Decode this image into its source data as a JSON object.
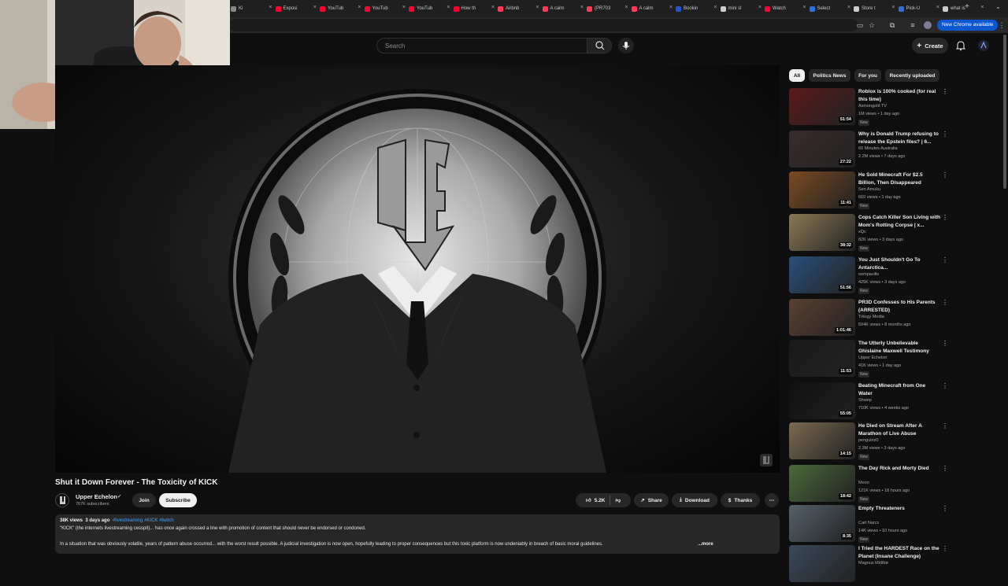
{
  "browser": {
    "tabs": [
      {
        "label": "Ki",
        "color": "#888888"
      },
      {
        "label": "Exposi",
        "color": "#ff0033"
      },
      {
        "label": "YouTub",
        "color": "#ff0033"
      },
      {
        "label": "YouTub",
        "color": "#ff0033"
      },
      {
        "label": "YouTub",
        "color": "#ff0033"
      },
      {
        "label": "How th",
        "color": "#ff0033"
      },
      {
        "label": "Airbnb",
        "color": "#ff385c"
      },
      {
        "label": "A calm",
        "color": "#ff385c"
      },
      {
        "label": "(PR703",
        "color": "#ff385c"
      },
      {
        "label": "A calm",
        "color": "#ff385c"
      },
      {
        "label": "Bookin",
        "color": "#2956c7"
      },
      {
        "label": "mini sl",
        "color": "#cccccc"
      },
      {
        "label": "Watch",
        "color": "#ff0033"
      },
      {
        "label": "Select",
        "color": "#2f6fd6"
      },
      {
        "label": "Store t",
        "color": "#cccccc"
      },
      {
        "label": "Pick-U",
        "color": "#2f6fd6"
      },
      {
        "label": "what is",
        "color": "#cccccc"
      }
    ],
    "update_label": "New Chrome available"
  },
  "header": {
    "search_placeholder": "Search",
    "create_label": "Create"
  },
  "video": {
    "title": "Shut it Down Forever - The Toxicity of KICK",
    "channel": "Upper Echelon",
    "subscribers": "767K subscribers",
    "join_label": "Join",
    "subscribe_label": "Subscribe",
    "likes": "5.2K",
    "share_label": "Share",
    "download_label": "Download",
    "thanks_label": "Thanks",
    "views": "38K views",
    "age": "3 days ago",
    "tags": "#livestreaming #KICK #twitch",
    "desc_line1": "\"KICK\" (the internets livestreaming cesspit)... has once again crossed a line with promotion of content that should never be endorsed or condoned.",
    "desc_line2": "In a situation that was obviously volatile, years of pattern abuse occurred... with the worst result possible. A judicial investigation is now open, hopefully leading to proper consequences but this toxic platform is now undeniably in breach of basic moral guidelines.",
    "more_label": "...more"
  },
  "sidebar": {
    "chips": [
      "All",
      "Politics News",
      "For you",
      "Recently uploaded"
    ],
    "new_label": "New",
    "items": [
      {
        "title": "Roblox is 100% cooked (for real this time)",
        "channel": "Asmongold TV",
        "stats": "1M views • 1 day ago",
        "duration": "51:54",
        "isnew": true,
        "thumb": "#5a1a1a"
      },
      {
        "title": "Why is Donald Trump refusing to release the Epstein files? | 6...",
        "channel": "60 Minutes Australia",
        "stats": "2.2M views • 7 days ago",
        "duration": "27:22",
        "isnew": false,
        "thumb": "#3a2b2b"
      },
      {
        "title": "He Sold Minecraft For $2.5 Billion, Then Disappeared",
        "channel": "Sen Amuku",
        "stats": "660 views • 1 day ago",
        "duration": "11:41",
        "isnew": true,
        "thumb": "#7a4a22"
      },
      {
        "title": "Cops Catch Killer Son Living with Mom's Rotting Corpse | x...",
        "channel": "xQc",
        "stats": "82K views • 3 days ago",
        "duration": "38:32",
        "isnew": true,
        "thumb": "#8a7a55"
      },
      {
        "title": "You Just Shouldn't Go To Antarctica...",
        "channel": "oompaville",
        "stats": "425K views • 3 days ago",
        "duration": "51:56",
        "isnew": true,
        "thumb": "#2a4f7a"
      },
      {
        "title": "PR3D Confesses to His Parents (ARRESTED)",
        "channel": "Trilogy Media",
        "stats": "594K views • 8 months ago",
        "duration": "1:01:46",
        "isnew": false,
        "thumb": "#5a4030"
      },
      {
        "title": "The Utterly Unbelievable Ghislaine Maxwell Testimony",
        "channel": "Upper Echelon",
        "stats": "41K views • 1 day ago",
        "duration": "11:53",
        "isnew": true,
        "thumb": "#1a1a1a"
      },
      {
        "title": "Beating Minecraft from One Water",
        "channel": "Shwep",
        "stats": "710K views • 4 weeks ago",
        "duration": "55:05",
        "isnew": false,
        "thumb": "#101010"
      },
      {
        "title": "He Died on Stream After A Marathon of Live Abuse",
        "channel": "penguinz0",
        "stats": "2.3M views • 3 days ago",
        "duration": "14:15",
        "isnew": true,
        "thumb": "#7a6a50"
      },
      {
        "title": "The Day Rick and Morty Died",
        "channel": "Moon",
        "stats": "121K views • 18 hours ago",
        "duration": "18:42",
        "isnew": true,
        "thumb": "#4a6a3a"
      },
      {
        "title": "Empty Threateners",
        "channel": "Cart Narcs",
        "stats": "14K views • 10 hours ago",
        "duration": "8:35",
        "isnew": true,
        "thumb": "#55606a"
      },
      {
        "title": "I Tried the HARDEST Race on the Planet (Insane Challenge)",
        "channel": "Magnus Midtbø",
        "stats": "",
        "duration": "",
        "isnew": false,
        "thumb": "#3a4a5a"
      }
    ]
  }
}
